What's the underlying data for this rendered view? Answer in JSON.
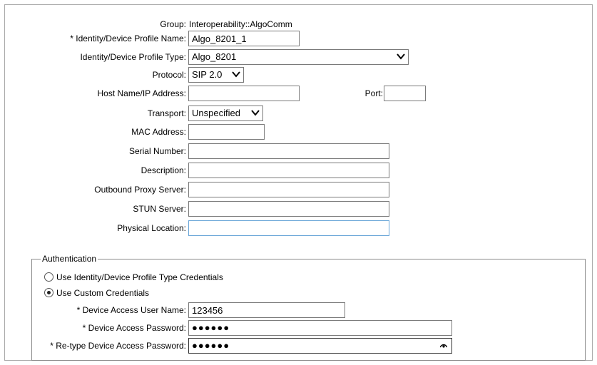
{
  "group": {
    "label": "Group:",
    "value": "Interoperability::AlgoComm"
  },
  "profile_name": {
    "label": "* Identity/Device Profile Name:",
    "value": "Algo_8201_1"
  },
  "profile_type": {
    "label": "Identity/Device Profile Type:",
    "value": "Algo_8201",
    "icon": "chevron-down-icon"
  },
  "protocol": {
    "label": "Protocol:",
    "value": "SIP 2.0",
    "icon": "chevron-down-icon"
  },
  "host": {
    "label": "Host Name/IP Address:",
    "value": ""
  },
  "port": {
    "label": "Port:",
    "value": ""
  },
  "transport": {
    "label": "Transport:",
    "value": "Unspecified",
    "icon": "chevron-down-icon"
  },
  "mac": {
    "label": "MAC Address:",
    "value": ""
  },
  "serial": {
    "label": "Serial Number:",
    "value": ""
  },
  "description": {
    "label": "Description:",
    "value": ""
  },
  "outbound_proxy": {
    "label": "Outbound Proxy Server:",
    "value": ""
  },
  "stun": {
    "label": "STUN Server:",
    "value": ""
  },
  "physical_location": {
    "label": "Physical Location:",
    "value": ""
  },
  "auth": {
    "legend": "Authentication",
    "option_profile": "Use Identity/Device Profile Type Credentials",
    "option_custom": "Use Custom Credentials",
    "selected": "custom",
    "user_label": "* Device Access User Name:",
    "user_value": "123456",
    "pwd_label": "* Device Access Password:",
    "pwd_value": "●●●●●●",
    "retype_label": "* Re-type Device Access Password:",
    "retype_value": "●●●●●●",
    "reveal_icon": "eye-icon"
  },
  "colors": {
    "field_border": "#7a7a7a",
    "focus_border": "#6aa6d8",
    "frame_border": "#a9a9a9"
  }
}
